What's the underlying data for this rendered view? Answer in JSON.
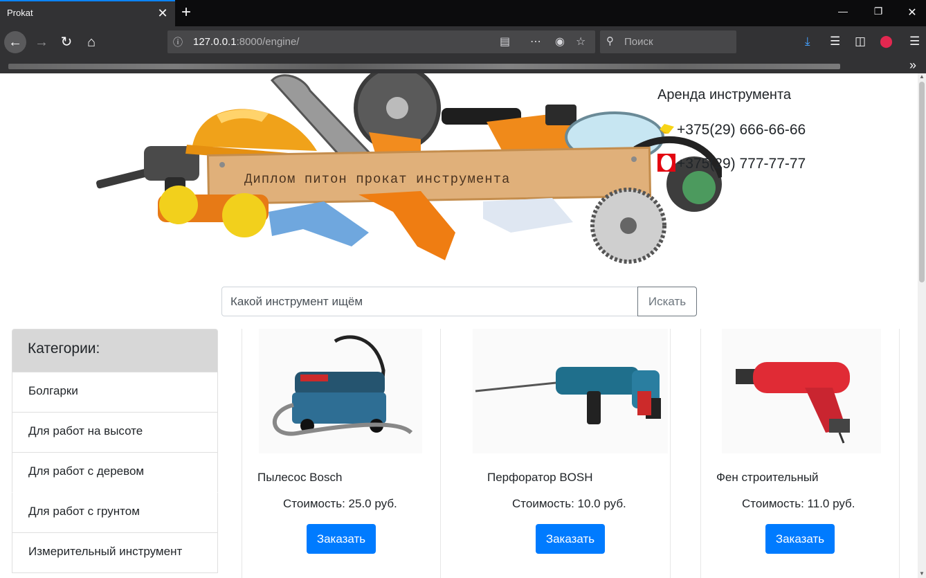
{
  "browser": {
    "tab_title": "Prokat",
    "tab_close": "✕",
    "new_tab": "+",
    "url_host": "127.0.0.1",
    "url_path": ":8000/engine/",
    "search_placeholder": "Поиск"
  },
  "banner": {
    "sign_text": "Диплом питон прокат инструмента"
  },
  "contact": {
    "title": "Аренда инструмента",
    "phone_1": "+375(29) 666-66-66",
    "phone_2": "+375(29) 777-77-77"
  },
  "search": {
    "placeholder": "Какой инструмент ищём",
    "button": "Искать"
  },
  "sidebar": {
    "header": "Категории:",
    "items": [
      "Болгарки",
      "Для работ на высоте",
      "Для работ с деревом",
      "Для работ с грунтом",
      "Измерительный инструмент"
    ]
  },
  "products": [
    {
      "title": "Пылесос Bosch",
      "price": "Стоимость: 25.0 руб.",
      "button": "Заказать",
      "color": "#2e6e94"
    },
    {
      "title": "Перфоратор BOSH",
      "price": "Стоимость: 10.0 руб.",
      "button": "Заказать",
      "color": "#1f6f8c"
    },
    {
      "title": "Фен строительный",
      "price": "Стоимость: 11.0 руб.",
      "button": "Заказать",
      "color": "#e02b35"
    }
  ],
  "colors": {
    "primary": "#007bff",
    "chrome_dark": "#323234",
    "tab_accent": "#0a84ff",
    "category_header_bg": "#d7d7d7"
  }
}
